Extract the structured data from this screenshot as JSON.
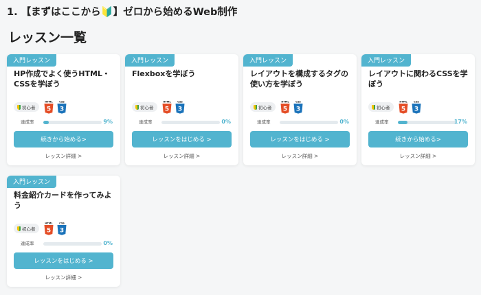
{
  "course": {
    "title": "1. 【まずはここから🔰】ゼロから始めるWeb制作"
  },
  "section": {
    "title": "レッスン一覧"
  },
  "colors": {
    "accent": "#52b4cf",
    "html_badge": "#e44d26",
    "css_badge": "#1b73ba"
  },
  "icons": {
    "level": "beginner-leaf-icon",
    "html": "html5-icon",
    "css": "css3-icon"
  },
  "lessons": [
    {
      "tag": "入門レッスン",
      "title": "HP作成でよく使うHTML・CSSを学ぼう",
      "level": "初心者",
      "html_label": "HTML",
      "css_label": "CSS",
      "progress_label": "達成率",
      "progress_percent": 9,
      "progress_text": "9%",
      "button_label": "続きから始める>",
      "detail_label": "レッスン詳細 >"
    },
    {
      "tag": "入門レッスン",
      "title": "Flexboxを学ぼう",
      "level": "初心者",
      "html_label": "HTML",
      "css_label": "CSS",
      "progress_label": "達成率",
      "progress_percent": 0,
      "progress_text": "0%",
      "button_label": "レッスンをはじめる >",
      "detail_label": "レッスン詳細 >"
    },
    {
      "tag": "入門レッスン",
      "title": "レイアウトを構成するタグの使い方を学ぼう",
      "level": "初心者",
      "html_label": "HTML",
      "css_label": "CSS",
      "progress_label": "達成率",
      "progress_percent": 0,
      "progress_text": "0%",
      "button_label": "レッスンをはじめる >",
      "detail_label": "レッスン詳細 >"
    },
    {
      "tag": "入門レッスン",
      "title": "レイアウトに関わるCSSを学ぼう",
      "level": "初心者",
      "html_label": "HTML",
      "css_label": "CSS",
      "progress_label": "達成率",
      "progress_percent": 17,
      "progress_text": "17%",
      "button_label": "続きから始める>",
      "detail_label": "レッスン詳細 >"
    },
    {
      "tag": "入門レッスン",
      "title": "料金紹介カードを作ってみよう",
      "level": "初心者",
      "html_label": "HTML",
      "css_label": "CSS",
      "progress_label": "達成率",
      "progress_percent": 0,
      "progress_text": "0%",
      "button_label": "レッスンをはじめる >",
      "detail_label": "レッスン詳細 >"
    }
  ]
}
